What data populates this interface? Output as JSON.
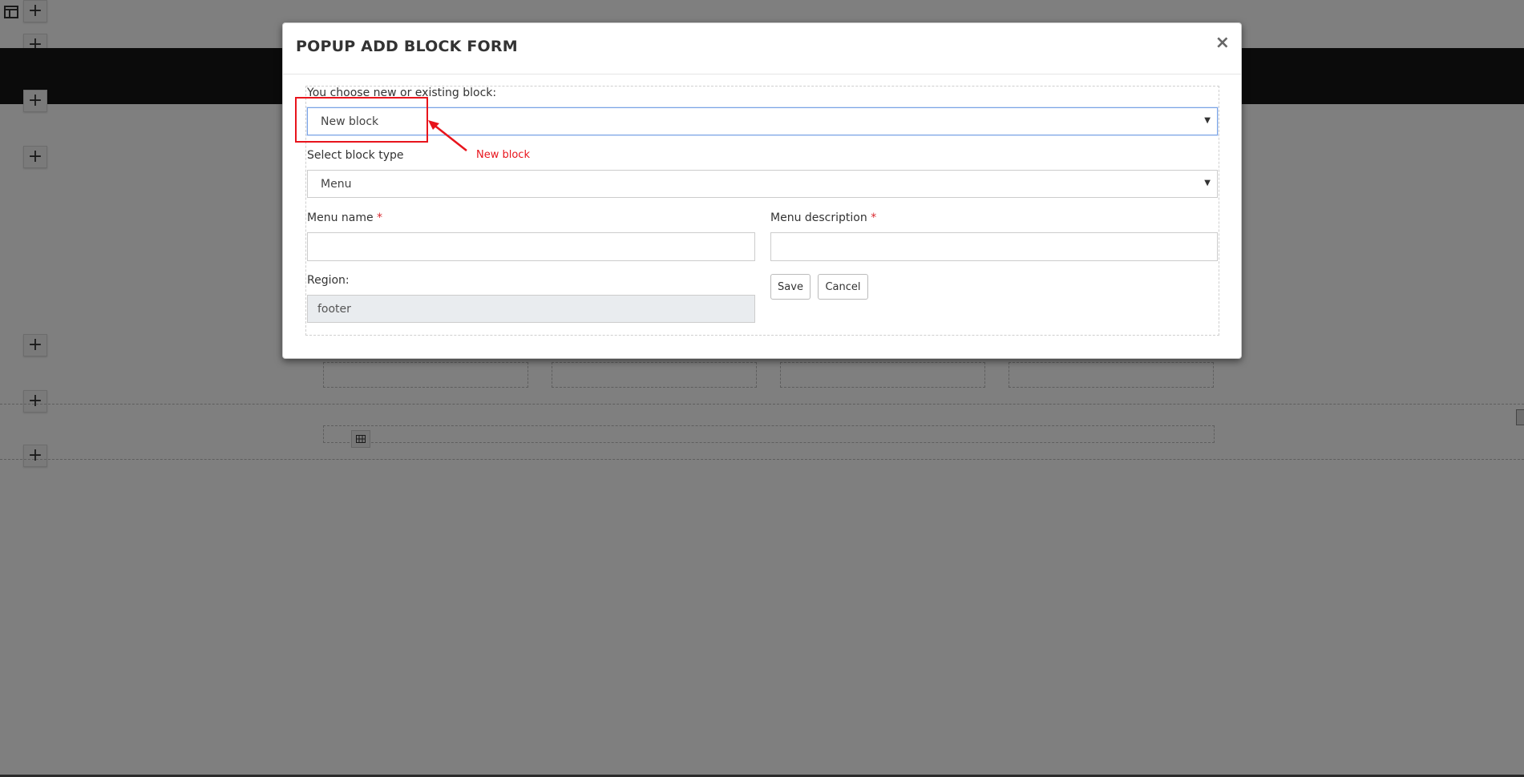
{
  "modal": {
    "title": "POPUP ADD BLOCK FORM",
    "close_label": "×",
    "choose_label": "You choose new or existing block:",
    "choose_value": "New block",
    "block_type_label": "Select block type",
    "block_type_value": "Menu",
    "menu_name_label": "Menu name",
    "menu_name_value": "",
    "menu_description_label": "Menu description",
    "menu_description_value": "",
    "required_mark": "*",
    "region_label": "Region:",
    "region_value": "footer",
    "save_label": "Save",
    "cancel_label": "Cancel"
  },
  "annotation": {
    "text": "New block",
    "color": "#e8141c"
  },
  "background_page": {
    "add_buttons": [
      "+",
      "+",
      "+",
      "+",
      "+",
      "+",
      "+"
    ]
  },
  "icons": [
    "layout-icon",
    "plus-icon",
    "close-icon",
    "chevron-down-icon",
    "grid-icon",
    "arrow-icon"
  ]
}
